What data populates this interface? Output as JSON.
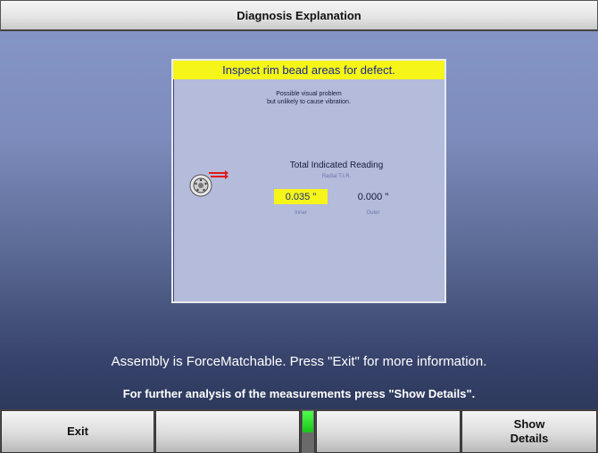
{
  "window": {
    "title": "Diagnosis Explanation"
  },
  "panel": {
    "heading": "Inspect rim bead areas for defect.",
    "subtext_line1": "Possible visual problem",
    "subtext_line2": "but unlikely to cause vibration.",
    "reading_title": "Total Indicated Reading",
    "reading_subtitle": "Radial T.I.R.",
    "inner_value": "0.035 \"",
    "outer_value": "0.000 \"",
    "inner_label": "Inner",
    "outer_label": "Outer",
    "icon": "wheel-rim-icon",
    "colors": {
      "highlight": "#f5f51a",
      "panel": "#b4bbdb"
    }
  },
  "messages": {
    "line1": "Assembly is ForceMatchable. Press \"Exit\" for more information.",
    "line2": "For further analysis of the measurements press \"Show Details\"."
  },
  "softkeys": {
    "key1": "Exit",
    "key2": "",
    "key3": "",
    "key4_line1": "Show",
    "key4_line2": "Details",
    "status_indicator": "green"
  }
}
